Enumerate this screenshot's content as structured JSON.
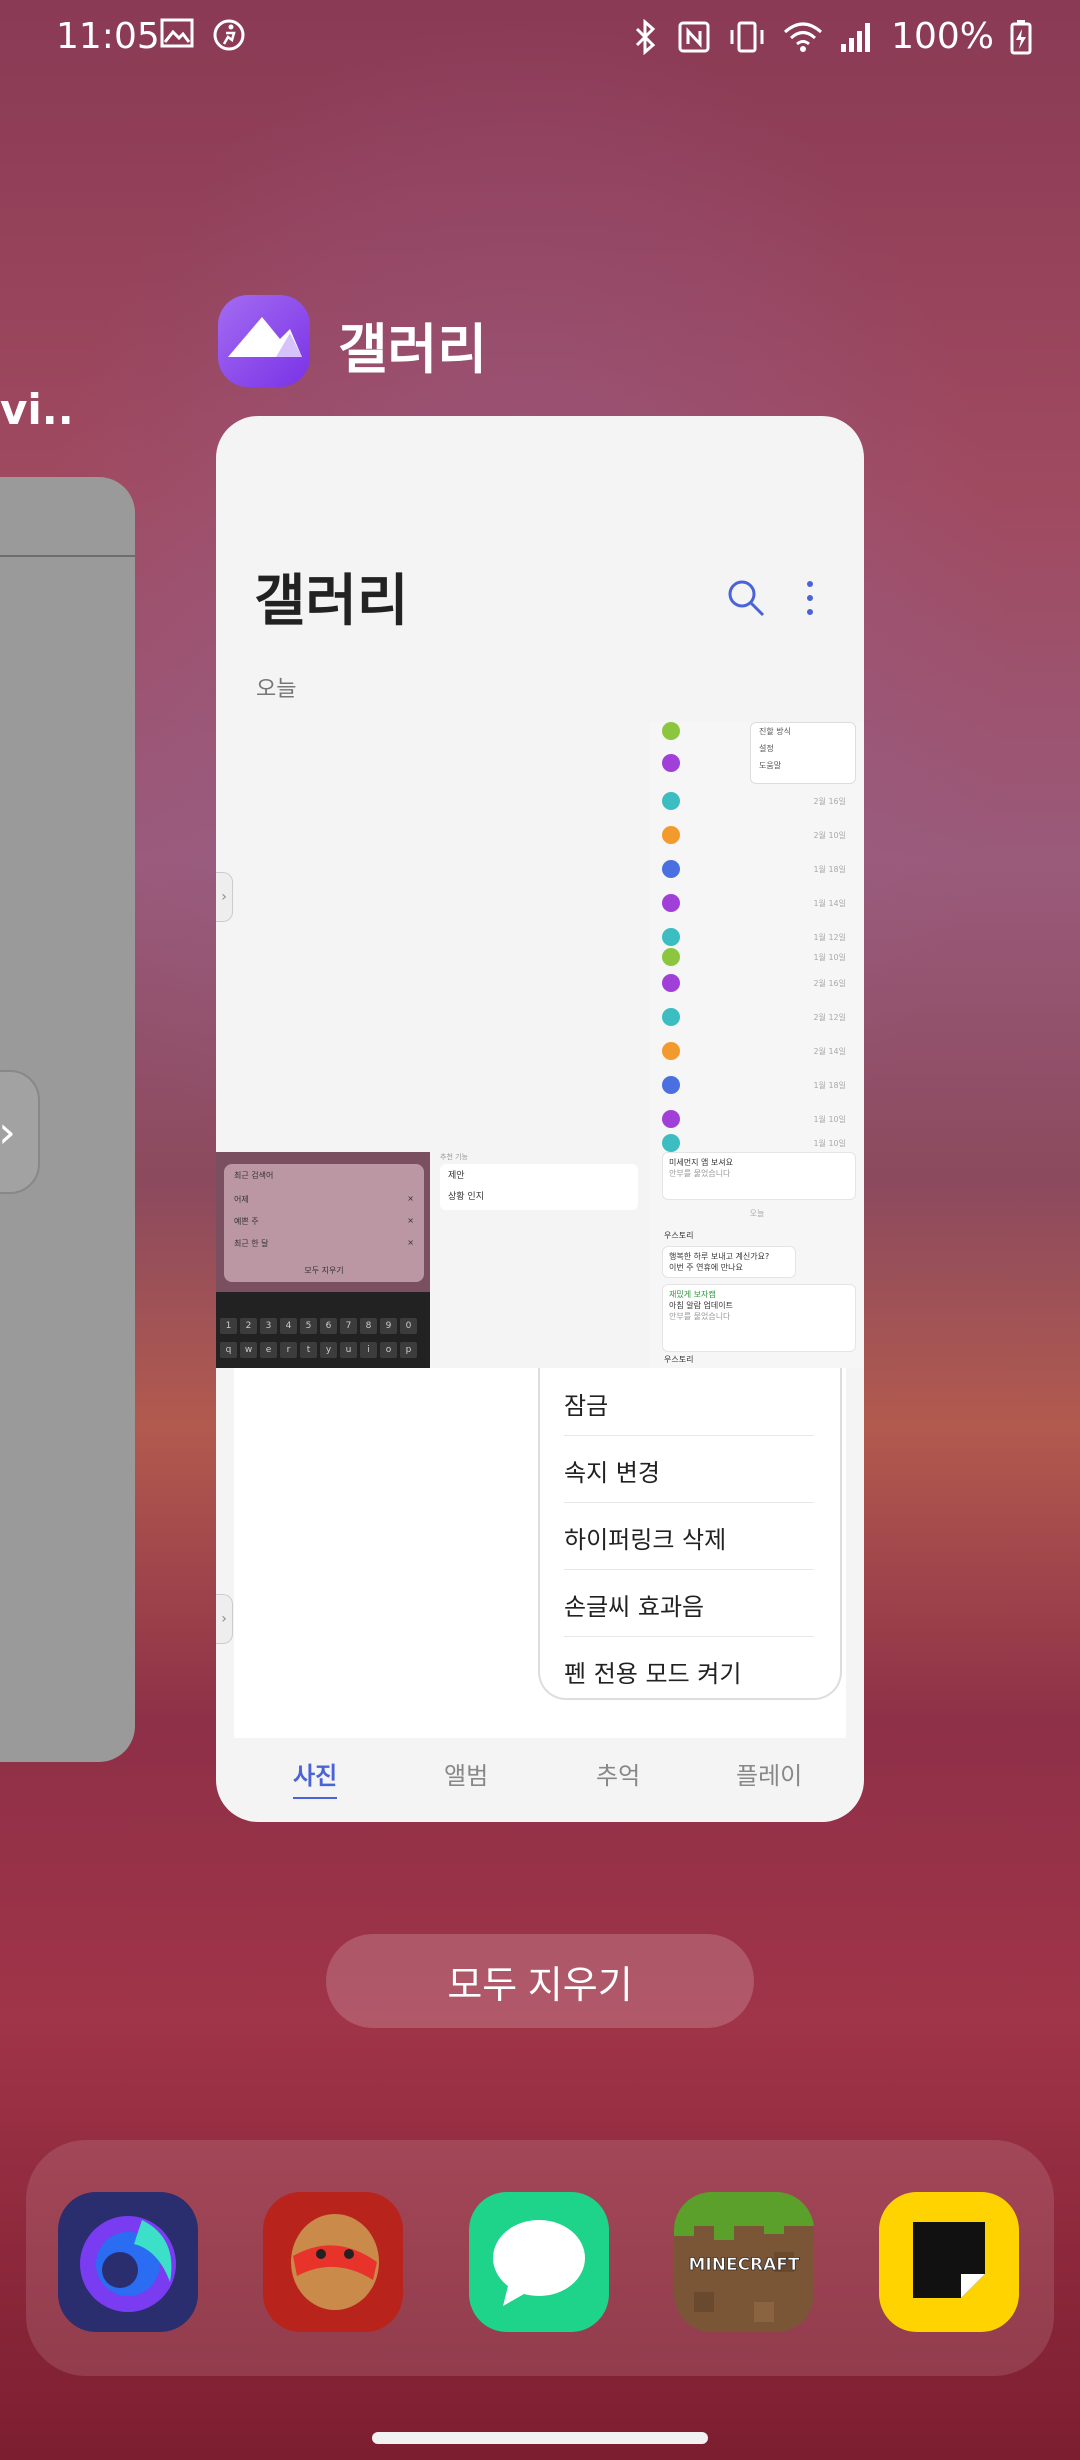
{
  "status_bar": {
    "time": "11:05",
    "left_icons": [
      "gallery-notification-icon",
      "activity-icon"
    ],
    "right_icons": [
      "bluetooth-icon",
      "nfc-icon",
      "vibrate-icon",
      "wifi-icon",
      "signal-icon",
      "battery-charging-icon"
    ],
    "battery_percent": "100%"
  },
  "recents": {
    "left_app_label": "vi..",
    "current_app": {
      "name": "갤러리",
      "icon": "gallery-app-icon",
      "accent": "#8a47ee"
    }
  },
  "gallery_preview": {
    "title": "갤러리",
    "section_label": "오늘",
    "chat_popup": [
      "진할 방식",
      "설정",
      "도움말"
    ],
    "chat_dates": [
      "2월 16일",
      "2월 10일",
      "1월 18일",
      "1월 14일",
      "1월 12일",
      "1월 10일",
      "2월 16일",
      "2월 12일",
      "2월 14일",
      "1월 18일",
      "1월 10일",
      "1월 10일"
    ],
    "recent_search": {
      "title": "최근 검색어",
      "items": [
        "어제",
        "예쁜 주",
        "최근 한 달"
      ],
      "clear_label": "모두 지우기"
    },
    "keyboard_rows": [
      [
        "1",
        "2",
        "3",
        "4",
        "5",
        "6",
        "7",
        "8",
        "9",
        "0"
      ],
      [
        "q",
        "w",
        "e",
        "r",
        "t",
        "y",
        "u",
        "i",
        "o",
        "p"
      ]
    ],
    "middle_box": {
      "caption": "추천 기능",
      "items": [
        "제안",
        "상황 인지"
      ]
    },
    "chat2": {
      "top_text": "미세먼지 앱 보셔요",
      "top_sub": "안부를 물었습니다",
      "date": "오늘",
      "sender": "우스토리",
      "msg1": "행복한 하루 보내고 계신가요?",
      "msg2": "이번 주 연휴에 만나요",
      "green_label": "재밌게 보자캠",
      "green_sub": "아침 알람 업데이트",
      "green_sub2": "안부를 물었습니다"
    },
    "menu_items": [
      "잠금",
      "속지 변경",
      "하이퍼링크 삭제",
      "손글씨 효과음",
      "펜 전용 모드 켜기"
    ],
    "tabs": [
      {
        "label": "사진",
        "active": true
      },
      {
        "label": "앨범",
        "active": false
      },
      {
        "label": "추억",
        "active": false
      },
      {
        "label": "플레이",
        "active": false
      }
    ]
  },
  "clear_all_label": "모두 지우기",
  "dock": {
    "apps": [
      "firefox-focus-icon",
      "cookie-run-icon",
      "messages-icon",
      "minecraft-icon",
      "memo-icon"
    ],
    "minecraft_label": "MINECRAFT"
  },
  "colors": {
    "accent_tab": "#4a63d8",
    "messages_green": "#1ed38a",
    "memo_yellow": "#ffd300"
  }
}
